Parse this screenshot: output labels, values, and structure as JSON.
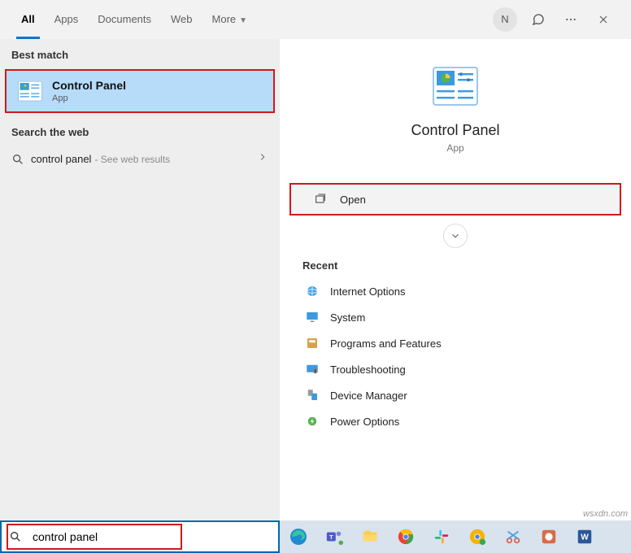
{
  "tabs": {
    "all": "All",
    "apps": "Apps",
    "documents": "Documents",
    "web": "Web",
    "more": "More"
  },
  "header": {
    "avatar_initial": "N"
  },
  "left": {
    "best_match_label": "Best match",
    "best_match": {
      "title": "Control Panel",
      "subtitle": "App"
    },
    "search_web_label": "Search the web",
    "web_query": "control panel",
    "web_suffix": "- See web results"
  },
  "right": {
    "title": "Control Panel",
    "subtitle": "App",
    "open_label": "Open",
    "recent_label": "Recent",
    "recent": [
      {
        "label": "Internet Options"
      },
      {
        "label": "System"
      },
      {
        "label": "Programs and Features"
      },
      {
        "label": "Troubleshooting"
      },
      {
        "label": "Device Manager"
      },
      {
        "label": "Power Options"
      }
    ]
  },
  "search": {
    "value": "control panel"
  },
  "watermark": "wsxdn.com"
}
